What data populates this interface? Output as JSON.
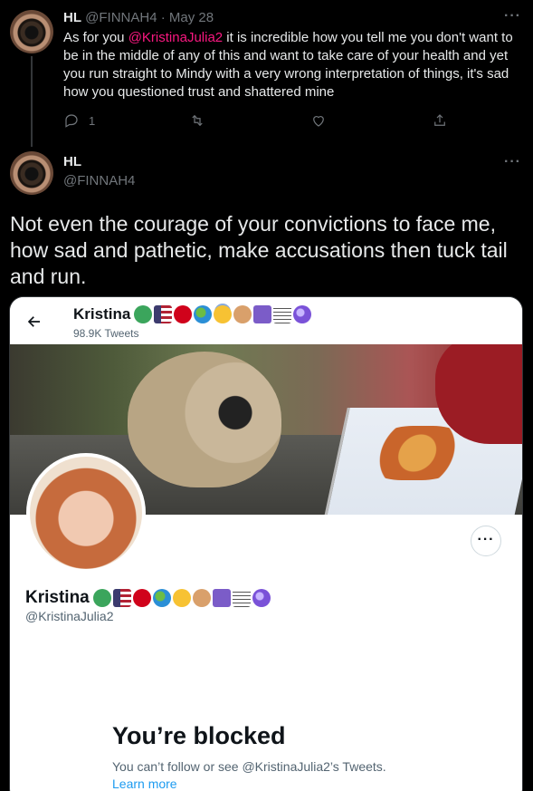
{
  "tweet1": {
    "name": "HL",
    "handle": "@FINNAH4",
    "separator": "·",
    "date": "May 28",
    "text_before": "As for you ",
    "mention": "@KristinaJulia2",
    "text_after": " it is incredible how you tell me you don't want to be in the middle of any of this and want to take care of your health and yet you run straight to Mindy with a very wrong interpretation of things, it's sad how you questioned trust and shattered mine",
    "reply_count": "1",
    "more": "···"
  },
  "tweet2": {
    "name": "HL",
    "handle": "@FINNAH4",
    "text": "Not even the courage of your convictions to face me, how sad and pathetic, make accusations then tuck tail and run.",
    "more": "···"
  },
  "card": {
    "header_name": "Kristina",
    "tweet_count": "98.9K Tweets",
    "profile_name": "Kristina",
    "profile_handle": "@KristinaJulia2",
    "more": "···",
    "blocked_title": "You’re blocked",
    "blocked_desc": "You can’t follow or see @KristinaJulia2’s Tweets.",
    "learn_more": "Learn more",
    "emojis": [
      "shamrock",
      "us-flag",
      "red-heart",
      "globe",
      "smiling-halo",
      "dog-face",
      "peace-symbol",
      "musical-score",
      "crystal-ball"
    ]
  },
  "colors": {
    "background": "#000000",
    "mention": "#f91880",
    "link": "#1d9bf0",
    "muted": "#71767b"
  }
}
